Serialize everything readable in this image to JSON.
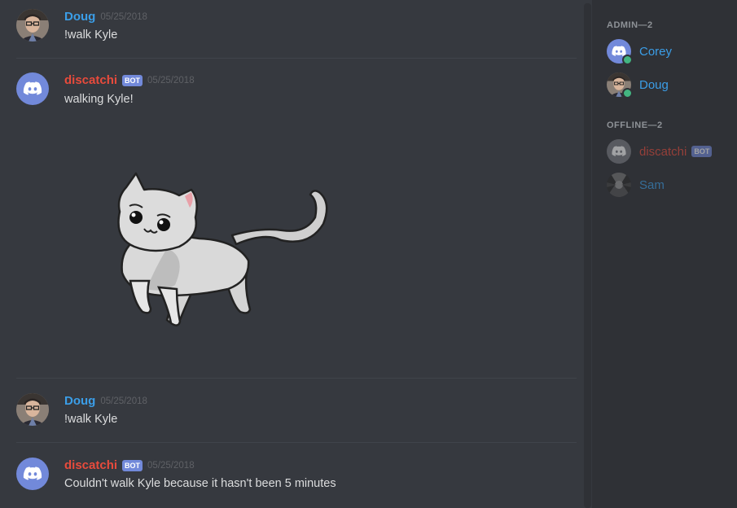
{
  "messages": [
    {
      "author": "Doug",
      "author_color": "#3b9ee8",
      "timestamp": "05/25/2018",
      "text": "!walk Kyle",
      "bot": false
    },
    {
      "author": "discatchi",
      "author_color": "#e84b3c",
      "timestamp": "05/25/2018",
      "text": "walking Kyle!",
      "bot": true,
      "bot_tag": "BOT",
      "attachment": "walking-cat-image"
    },
    {
      "author": "Doug",
      "author_color": "#3b9ee8",
      "timestamp": "05/25/2018",
      "text": "!walk Kyle",
      "bot": false
    },
    {
      "author": "discatchi",
      "author_color": "#e84b3c",
      "timestamp": "05/25/2018",
      "text": "Couldn't walk Kyle because it hasn't been 5 minutes",
      "bot": true,
      "bot_tag": "BOT"
    }
  ],
  "members": {
    "admin_title": "ADMIN—2",
    "admins": [
      {
        "name": "Corey",
        "color": "#3b9ee8",
        "online": true,
        "avatar": "discord-logo-icon"
      },
      {
        "name": "Doug",
        "color": "#3b9ee8",
        "online": true,
        "avatar": "user-photo"
      }
    ],
    "offline_title": "OFFLINE—2",
    "offline": [
      {
        "name": "discatchi",
        "color": "#e84b3c",
        "bot_tag": "BOT",
        "avatar": "discord-logo-icon"
      },
      {
        "name": "Sam",
        "color": "#3b9ee8",
        "avatar": "user-photo"
      }
    ]
  },
  "colors": {
    "background": "#36393f",
    "sidebar": "#2f3136",
    "blurple": "#7289da",
    "online": "#43b581"
  }
}
